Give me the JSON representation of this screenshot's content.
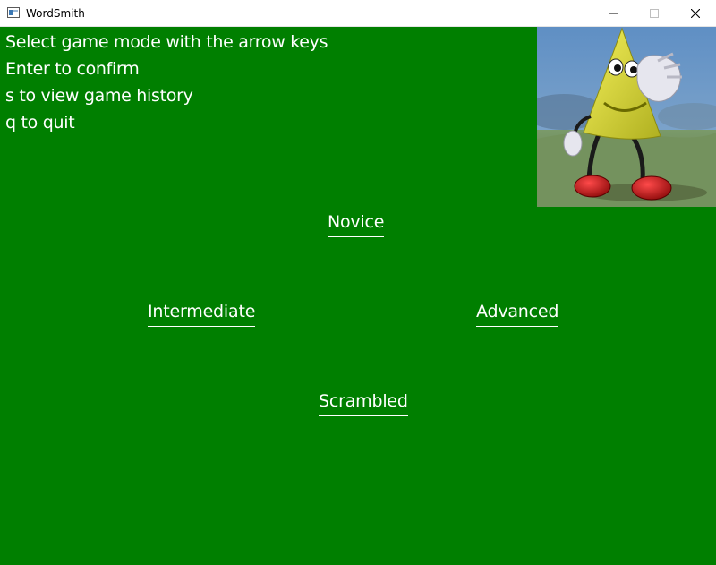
{
  "window": {
    "title": "WordSmith",
    "controls": [
      "minimize-icon",
      "maximize-icon",
      "close-icon"
    ]
  },
  "instructions": [
    "Select game mode with the arrow keys",
    "Enter to confirm",
    "s to view game history",
    "q to quit"
  ],
  "modes": {
    "novice": "Novice",
    "intermediate": "Intermediate",
    "advanced": "Advanced",
    "scrambled": "Scrambled"
  },
  "colors": {
    "background": "#007f00",
    "text": "#ffffff"
  },
  "image": {
    "semantic": "mascot-character-image"
  }
}
